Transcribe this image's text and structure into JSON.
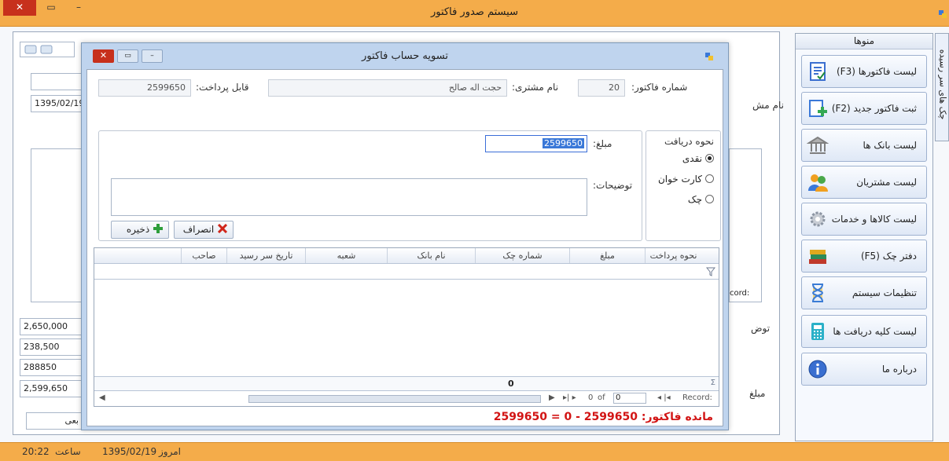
{
  "app": {
    "title": "سیستم صدور فاکتور",
    "status": {
      "time_label": "ساعت",
      "time": "20:22",
      "today_label": "امروز",
      "today": "1395/02/19"
    }
  },
  "background_form": {
    "date": "1395/02/19",
    "customer_label": "نام مش",
    "desc_label": "توض",
    "amount_label": "مبلغ",
    "record_text": "cord:",
    "total1": "2,650,000",
    "total2": "238,500",
    "total3": "288850",
    "total4": "2,599,650",
    "button_text": "بعی"
  },
  "menu": {
    "header": "منوها",
    "vertical_tab": "چک های سر رسیده",
    "items": [
      {
        "label": "لیست فاکتورها (F3)",
        "icon": "invoice-list-icon",
        "color": "#3b6fd0"
      },
      {
        "label": "ثبت فاکتور جدید (F2)",
        "icon": "new-invoice-icon",
        "color": "#34a853"
      },
      {
        "label": "لیست بانک ها",
        "icon": "bank-list-icon",
        "color": "#8c8c8c"
      },
      {
        "label": "لیست مشتریان",
        "icon": "customers-icon",
        "color": "#f0a020"
      },
      {
        "label": "لیست کالاها و خدمات",
        "icon": "gears-icon",
        "color": "#9aa3b0"
      },
      {
        "label": "دفتر چک (F5)",
        "icon": "books-icon",
        "color": "#c0392b"
      },
      {
        "label": "تنظیمات سیستم",
        "icon": "hourglass-icon",
        "color": "#3a7bd5"
      },
      {
        "label": "لیست کلیه دریافت ها",
        "icon": "calculator-icon",
        "color": "#2bb0c8"
      },
      {
        "label": "درباره ما",
        "icon": "info-icon",
        "color": "#3a6fd0"
      }
    ]
  },
  "dialog": {
    "title": "تسویه حساب فاکتور",
    "invoice_no_label": "شماره فاکتور:",
    "invoice_no": "20",
    "customer_label": "نام مشتری:",
    "customer": "حجت اله صالح",
    "payable_label": "قابل پرداخت:",
    "payable": "2599650",
    "group_title": "نحوه دریافت",
    "radios": [
      {
        "label": "نقدی",
        "checked": true
      },
      {
        "label": "کارت خوان",
        "checked": false
      },
      {
        "label": "چک",
        "checked": false
      }
    ],
    "amount_label": "مبلغ:",
    "amount": "2599650",
    "desc_label": "توضیحات:",
    "cancel_label": "انصراف",
    "save_label": "ذخیره",
    "grid": {
      "columns": [
        "نحوه پرداخت",
        "مبلغ",
        "شماره چک",
        "نام بانک",
        "شعبه",
        "تاریخ سر رسید",
        "صاحب"
      ],
      "sum": "0",
      "nav": {
        "record_label": "Record:",
        "position": "0",
        "of_label": "of",
        "count": "0"
      }
    },
    "remaining": "مانده فاکتور: 2599650 - 0 = 2599650"
  }
}
